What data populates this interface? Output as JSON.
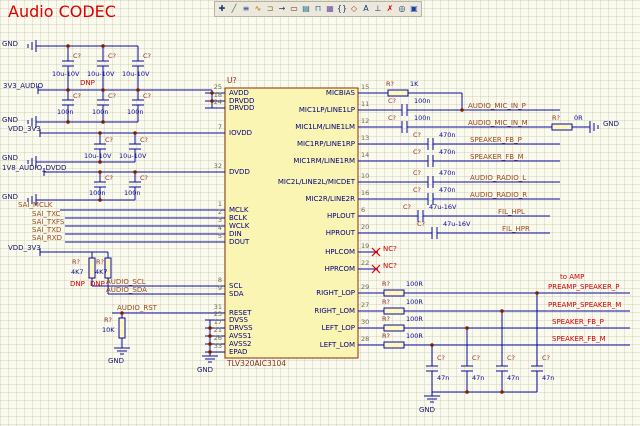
{
  "title": "Audio CODEC",
  "toolbar": {
    "icons": [
      {
        "name": "cursor",
        "glyph": "✚"
      },
      {
        "name": "place-wire",
        "glyph": "╱"
      },
      {
        "name": "place-bus",
        "glyph": "≡"
      },
      {
        "name": "place-signal-harness",
        "glyph": "∿"
      },
      {
        "name": "place-harness-connector",
        "glyph": "⊐"
      },
      {
        "name": "place-harness-entry",
        "glyph": "→"
      },
      {
        "name": "place-part",
        "glyph": "▭"
      },
      {
        "name": "place-sheet-symbol",
        "glyph": "▤"
      },
      {
        "name": "place-sheet-entry",
        "glyph": "⊓"
      },
      {
        "name": "place-device-sheet",
        "glyph": "▦"
      },
      {
        "name": "place-code-symbol",
        "glyph": "{}"
      },
      {
        "name": "place-port",
        "glyph": "◇"
      },
      {
        "name": "place-net-label",
        "glyph": "A"
      },
      {
        "name": "place-power-port",
        "glyph": "⊥"
      },
      {
        "name": "place-no-erc",
        "glyph": "✗"
      },
      {
        "name": "place-probe",
        "glyph": "◎"
      },
      {
        "name": "place-parameter",
        "glyph": "▣"
      }
    ]
  },
  "ic": {
    "designator": "U?",
    "part_number": "TLV320AIC3104",
    "left_pins": [
      {
        "name": "AVDD",
        "num": "25"
      },
      {
        "name": "DRVDD",
        "num": "18"
      },
      {
        "name": "DRVDD",
        "num": "24"
      },
      {
        "name": "IOVDD",
        "num": "7"
      },
      {
        "name": "DVDD",
        "num": "32"
      },
      {
        "name": "MCLK",
        "num": "1"
      },
      {
        "name": "BCLK",
        "num": "2"
      },
      {
        "name": "WCLK",
        "num": "3"
      },
      {
        "name": "DIN",
        "num": "4"
      },
      {
        "name": "DOUT",
        "num": "5"
      },
      {
        "name": "SCL",
        "num": "8"
      },
      {
        "name": "SDA",
        "num": "9"
      },
      {
        "name": "RESET",
        "num": "31"
      },
      {
        "name": "DVSS",
        "num": "23"
      },
      {
        "name": "DRVSS",
        "num": "17"
      },
      {
        "name": "AVSS1",
        "num": "21"
      },
      {
        "name": "AVSS2",
        "num": "26"
      },
      {
        "name": "EPAD",
        "num": "33"
      }
    ],
    "right_pins": [
      {
        "name": "MICBIAS",
        "num": "15"
      },
      {
        "name": "MIC1LP/LINE1LP",
        "num": "11"
      },
      {
        "name": "MIC1LM/LINE1LM",
        "num": "12"
      },
      {
        "name": "MIC1RP/LINE1RP",
        "num": "13"
      },
      {
        "name": "MIC1RM/LINE1RM",
        "num": "14"
      },
      {
        "name": "MIC2L/LINE2L/MICDET",
        "num": "10"
      },
      {
        "name": "MIC2R/LINE2R",
        "num": "16"
      },
      {
        "name": "HPLOUT",
        "num": "6"
      },
      {
        "name": "HPROUT",
        "num": "20"
      },
      {
        "name": "HPLCOM",
        "num": "19"
      },
      {
        "name": "HPRCOM",
        "num": "22"
      },
      {
        "name": "RIGHT_LOP",
        "num": "29"
      },
      {
        "name": "RIGHT_LOM",
        "num": "27"
      },
      {
        "name": "LEFT_LOP",
        "num": "30"
      },
      {
        "name": "LEFT_LOM",
        "num": "28"
      }
    ]
  },
  "refs": {
    "cap": "C?",
    "res": "R?",
    "nc": "NC?"
  },
  "values": {
    "c10u": "10u-10V",
    "c100n": "100n",
    "c470n": "470n",
    "c47u": "47u-16V",
    "c47n": "47n",
    "r1k": "1K",
    "r0": "0R",
    "r100": "100R",
    "r4k7": "4K7",
    "r10k": "10K"
  },
  "power": {
    "gnd": "GND",
    "audio_3v3": "3V3_AUDIO",
    "vdd_3v3": "VDD_3V3",
    "dvdd_1v8": "1V8_AUDIO_DVDD"
  },
  "nets": {
    "sai_mclk": "SAI_MCLK",
    "sai_txc": "SAI_TXC",
    "sai_txfs": "SAI_TXFS",
    "sai_txd": "SAI_TXD",
    "sai_rxd": "SAI_RXD",
    "audio_scl": "AUDIO_SCL",
    "audio_sda": "AUDIO_SDA",
    "audio_rst": "AUDIO_RST",
    "mic_in_p": "AUDIO_MIC_IN_P",
    "mic_in_m": "AUDIO_MIC_IN_M",
    "spk_fb_p": "SPEAKER_FB_P",
    "spk_fb_m": "SPEAKER_FB_M",
    "radio_l": "AUDIO_RADIO_L",
    "radio_r": "AUDIO_RADIO_R",
    "fil_hpl": "FIL_HPL",
    "fil_hpr": "FIL_HPR",
    "preamp_p": "PREAMP_SPEAKER_P",
    "preamp_m": "PREAMP_SPEAKER_M"
  },
  "flags": {
    "dnp": "DNP",
    "to_amp": "to AMP"
  },
  "colors": {
    "wire": "#0a0aa0",
    "net_label": "#9c4a1a",
    "red_label": "#d40000",
    "ic_fill": "#fbf5b4",
    "ic_border": "#8b3000"
  }
}
